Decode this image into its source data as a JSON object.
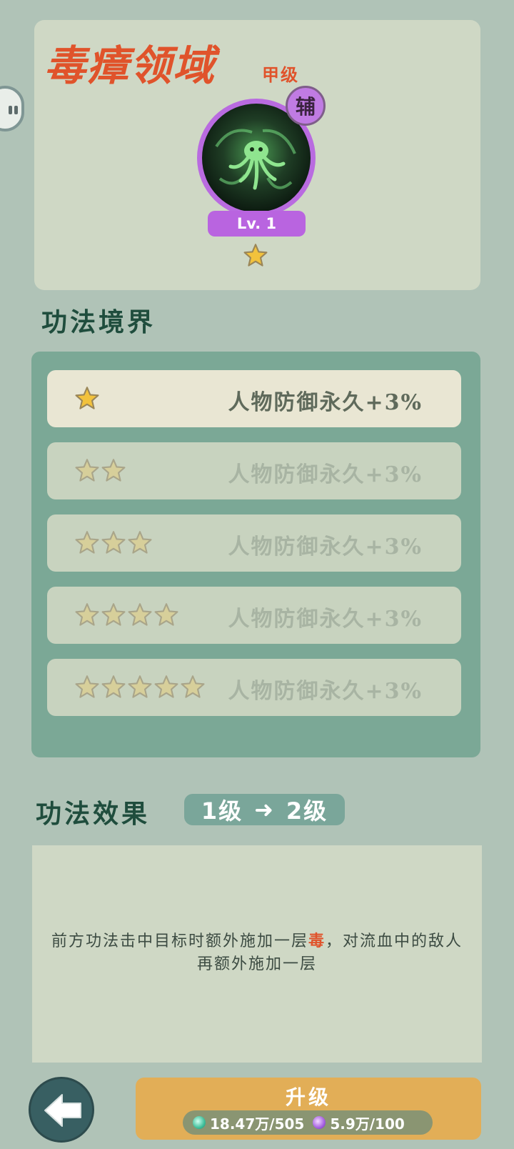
{
  "skill": {
    "name": "毒瘴领域",
    "grade": "甲级",
    "role": "辅",
    "level_label": "Lv. 1",
    "current_stars": 1
  },
  "realm": {
    "title": "功法境界",
    "rows": [
      {
        "stars": 1,
        "text": "人物防御永久+3%",
        "active": true
      },
      {
        "stars": 2,
        "text": "人物防御永久+3%",
        "active": false
      },
      {
        "stars": 3,
        "text": "人物防御永久+3%",
        "active": false
      },
      {
        "stars": 4,
        "text": "人物防御永久+3%",
        "active": false
      },
      {
        "stars": 5,
        "text": "人物防御永久+3%",
        "active": false
      }
    ]
  },
  "effect": {
    "title": "功法效果",
    "from_level": "1级",
    "arrow": "➜",
    "to_level": "2级",
    "text_before": "前方功法击中目标时额外施加一层",
    "text_highlight": "毒",
    "text_after": "，对流血中的敌人再额外施加一层"
  },
  "upgrade": {
    "label": "升级",
    "cost_spirit": "18.47万/505",
    "cost_essence": "5.9万/100"
  },
  "colors": {
    "accent_red": "#e0532b",
    "level_purple": "#b964e0",
    "upgrade_orange": "#e2ae57",
    "panel_green": "#7ba896"
  }
}
